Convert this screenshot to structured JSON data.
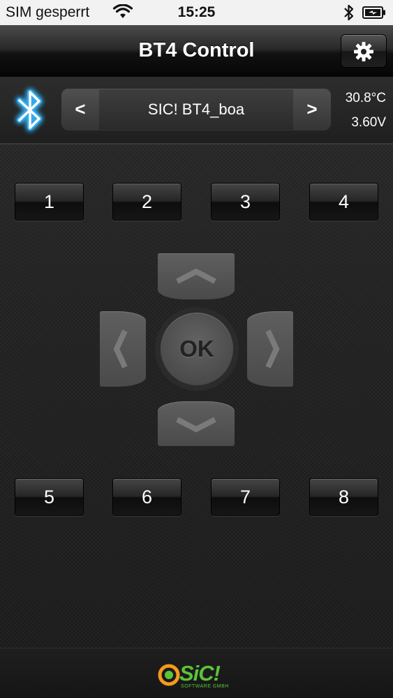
{
  "status_bar": {
    "carrier": "SIM gesperrt",
    "time": "15:25"
  },
  "nav": {
    "title": "BT4 Control"
  },
  "device": {
    "prev_label": "<",
    "name": "SIC! BT4_boa",
    "next_label": ">",
    "temperature": "30.8°C",
    "voltage": "3.60V"
  },
  "buttons_top": [
    "1",
    "2",
    "3",
    "4"
  ],
  "buttons_bottom": [
    "5",
    "6",
    "7",
    "8"
  ],
  "dpad": {
    "ok_label": "OK"
  },
  "footer": {
    "brand": "SiC!",
    "tagline": "SOFTWARE GMBH"
  },
  "icons": {
    "wifi": "wifi-icon",
    "bluetooth_status": "bluetooth-icon",
    "battery": "battery-charging-icon",
    "settings": "gear-icon",
    "bluetooth_main": "bluetooth-glow-icon",
    "logo": "sic-logo-icon"
  },
  "colors": {
    "bluetooth_glow": "#39b8ff",
    "brand_green": "#5cc238",
    "brand_orange": "#f39a1f"
  }
}
